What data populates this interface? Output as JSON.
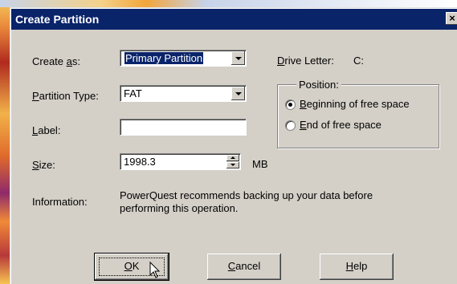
{
  "window": {
    "title": "Create Partition",
    "close_glyph": "×"
  },
  "form": {
    "create_as": {
      "label_prefix": "Create ",
      "label_key": "a",
      "label_suffix": "s:",
      "value": "Primary Partition"
    },
    "partition_type": {
      "label_key": "P",
      "label_suffix": "artition Type:",
      "value": "FAT"
    },
    "label": {
      "label_key": "L",
      "label_suffix": "abel:",
      "value": ""
    },
    "size": {
      "label_key": "S",
      "label_suffix": "ize:",
      "value": "1998.3",
      "unit": "MB"
    },
    "drive_letter": {
      "label_key": "D",
      "label_suffix": "rive Letter:",
      "value": "C:"
    },
    "information": {
      "label": "Information:",
      "line1": "PowerQuest recommends backing up your data before",
      "line2": "performing this operation."
    }
  },
  "position": {
    "legend": "Position:",
    "options": [
      {
        "key": "B",
        "rest": "eginning of free space",
        "selected": true
      },
      {
        "key": "E",
        "rest": "nd of free space",
        "selected": false
      }
    ]
  },
  "buttons": {
    "ok": {
      "key": "O",
      "rest": "K"
    },
    "cancel": {
      "key": "C",
      "rest": "ancel"
    },
    "help": {
      "key": "H",
      "rest": "elp"
    }
  }
}
